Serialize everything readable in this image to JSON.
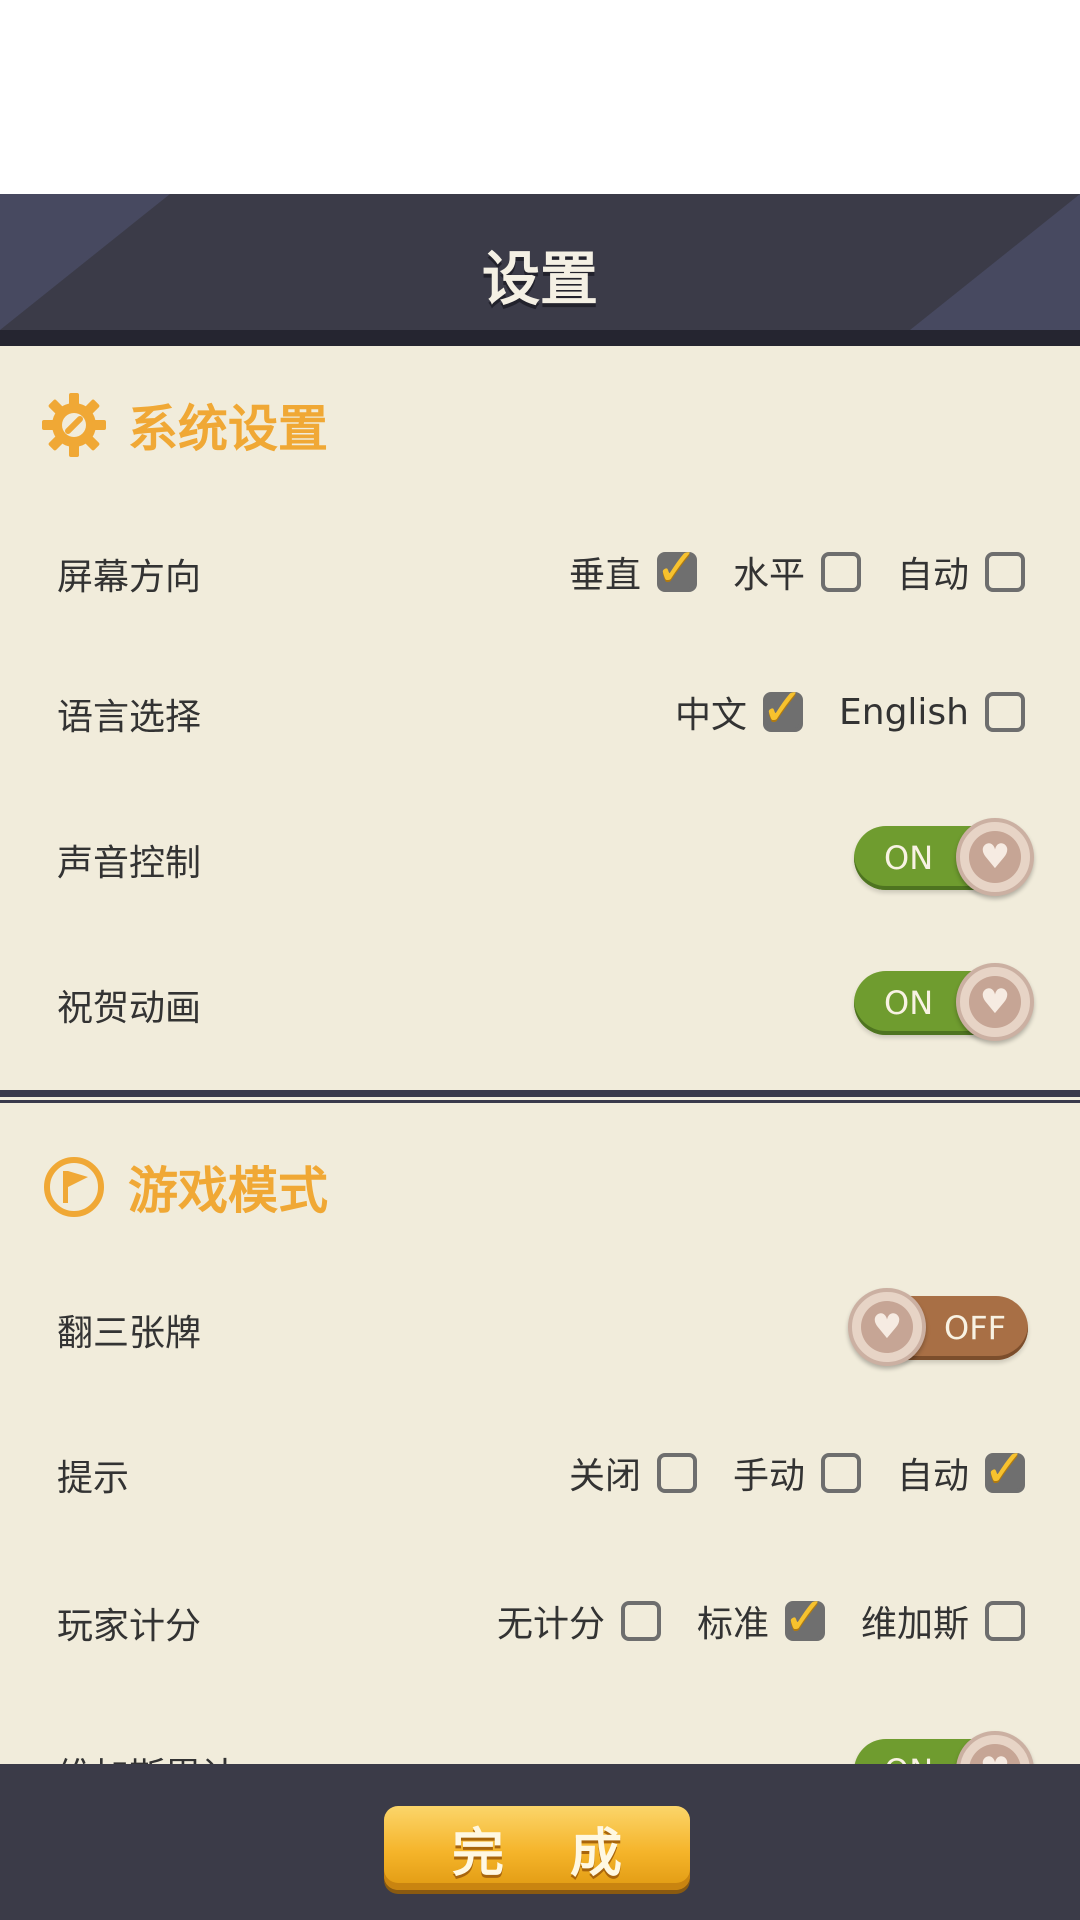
{
  "header": {
    "title": "设置"
  },
  "system_settings": {
    "title": "系统设置",
    "icon": "gear-icon",
    "screen_orientation": {
      "label": "屏幕方向",
      "options": [
        {
          "label": "垂直",
          "checked": true
        },
        {
          "label": "水平",
          "checked": false
        },
        {
          "label": "自动",
          "checked": false
        }
      ]
    },
    "language": {
      "label": "语言选择",
      "options": [
        {
          "label": "中文",
          "checked": true
        },
        {
          "label": "English",
          "checked": false
        }
      ]
    },
    "sound": {
      "label": "声音控制",
      "state": "ON"
    },
    "celebration": {
      "label": "祝贺动画",
      "state": "ON"
    }
  },
  "game_mode": {
    "title": "游戏模式",
    "icon": "flag-icon",
    "draw_three": {
      "label": "翻三张牌",
      "state": "OFF"
    },
    "hint": {
      "label": "提示",
      "options": [
        {
          "label": "关闭",
          "checked": false
        },
        {
          "label": "手动",
          "checked": false
        },
        {
          "label": "自动",
          "checked": true
        }
      ]
    },
    "scoring": {
      "label": "玩家计分",
      "options": [
        {
          "label": "无计分",
          "checked": false
        },
        {
          "label": "标准",
          "checked": true
        },
        {
          "label": "维加斯",
          "checked": false
        }
      ]
    },
    "vegas_cumulative": {
      "label": "维加斯累计",
      "state": "ON"
    }
  },
  "footer": {
    "done_label": "完 成"
  },
  "colors": {
    "accent": "#f0a835",
    "toggle_on": "#6f9c2f",
    "toggle_off": "#a86f45",
    "header_bg": "#3b3b48",
    "content_bg": "#f1ecdb"
  }
}
